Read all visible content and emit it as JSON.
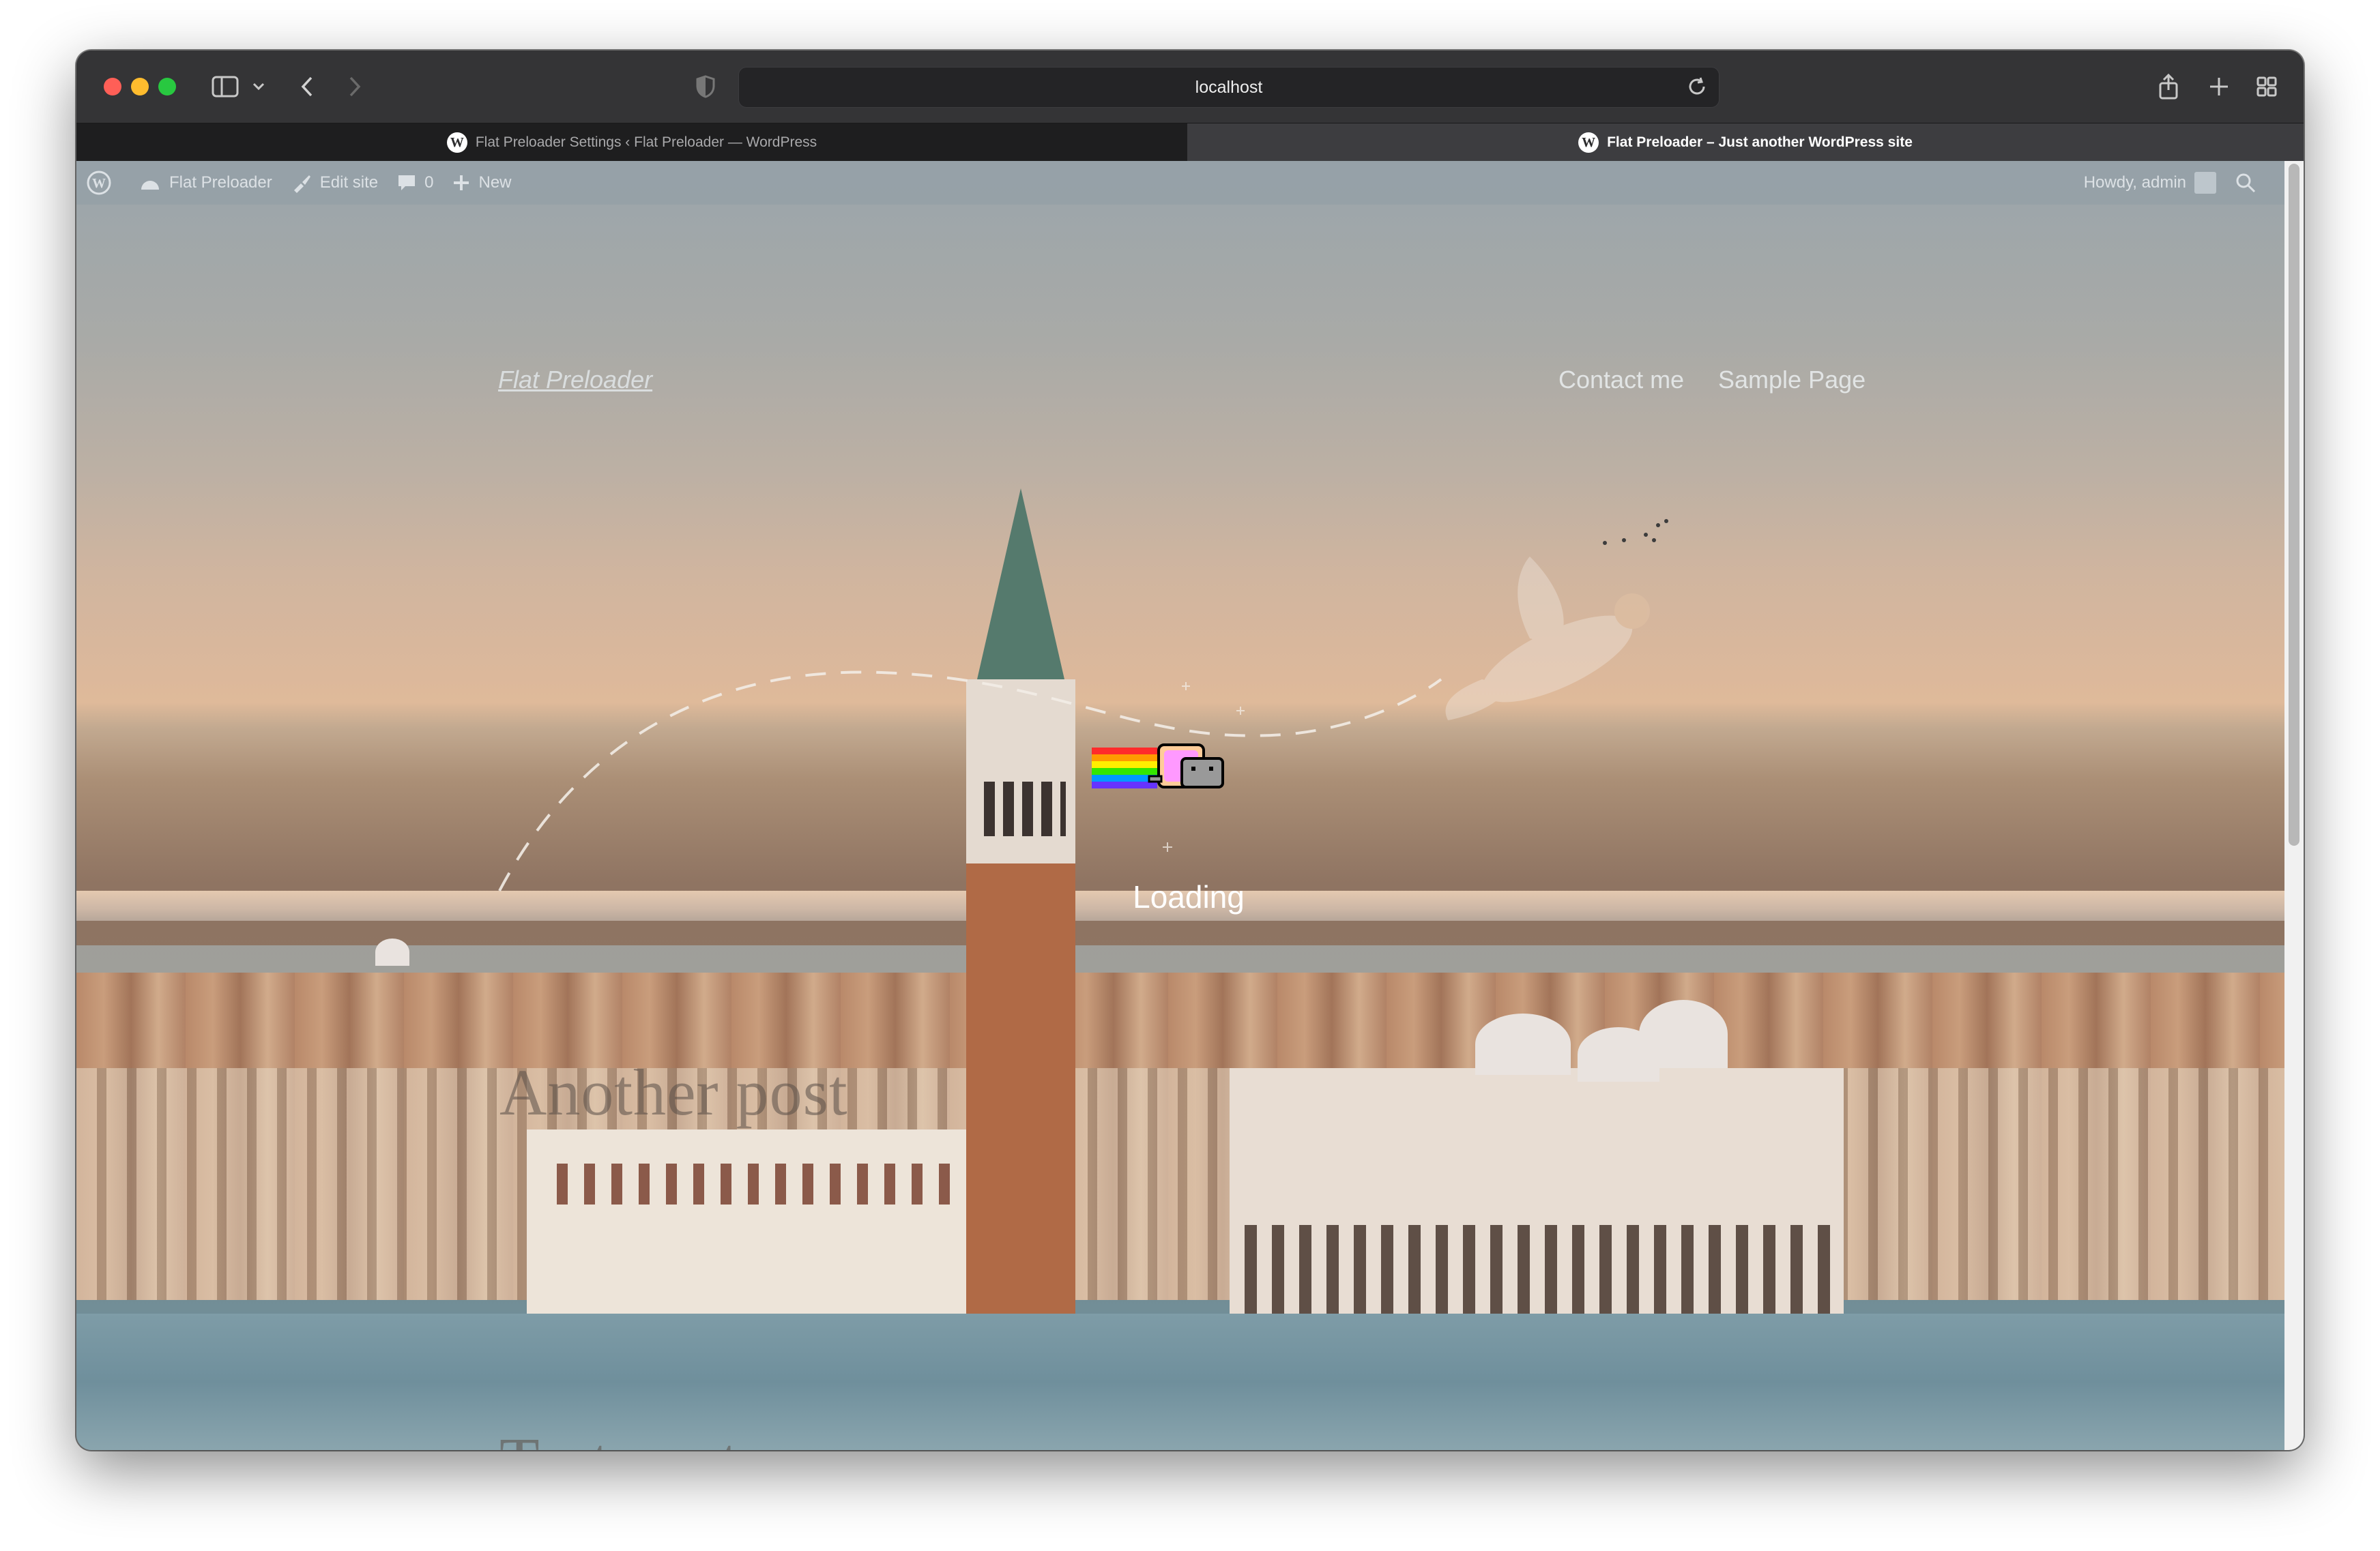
{
  "browser": {
    "url": "localhost",
    "tabs": [
      {
        "title": "Flat Preloader Settings ‹ Flat Preloader — WordPress",
        "active": false
      },
      {
        "title": "Flat Preloader – Just another WordPress site",
        "active": true
      }
    ]
  },
  "admin_bar": {
    "site_name": "Flat Preloader",
    "edit_site": "Edit site",
    "comments_count": "0",
    "new_label": "New",
    "howdy": "Howdy, admin"
  },
  "site": {
    "title": "Flat Preloader",
    "nav": [
      "Contact me",
      "Sample Page"
    ]
  },
  "posts": {
    "first_title": "Another post",
    "second_title": "Test post"
  },
  "preloader": {
    "text": "Loading",
    "icon": "nyan-cat-icon"
  },
  "colors": {
    "accent_white": "#ffffff",
    "admin_bar": "#95a0a7"
  }
}
